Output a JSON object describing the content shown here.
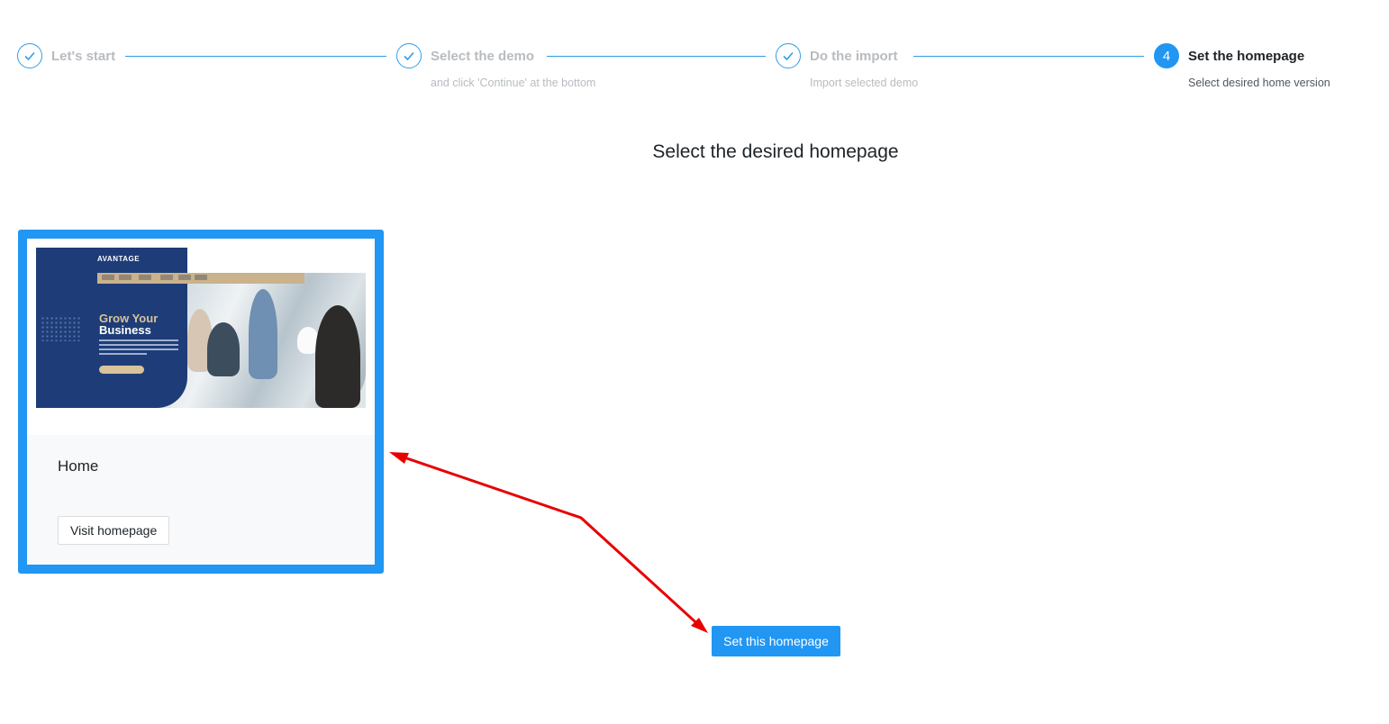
{
  "steps": [
    {
      "number": "1",
      "title": "Let's start",
      "subtitle": "",
      "state": "done"
    },
    {
      "number": "2",
      "title": "Select the demo",
      "subtitle": "and click 'Continue' at the bottom",
      "state": "done"
    },
    {
      "number": "3",
      "title": "Do the import",
      "subtitle": "Import selected demo",
      "state": "done"
    },
    {
      "number": "4",
      "title": "Set the homepage",
      "subtitle": "Select desired home version",
      "state": "active"
    }
  ],
  "page_title": "Select the desired homepage",
  "card": {
    "title": "Home",
    "visit_label": "Visit homepage",
    "preview": {
      "logo": "AVANTAGE",
      "headline_1": "Grow Your",
      "headline_2": "Business"
    }
  },
  "set_button_label": "Set this homepage",
  "colors": {
    "accent": "#2196f3",
    "annotation_arrow": "#e80000"
  }
}
